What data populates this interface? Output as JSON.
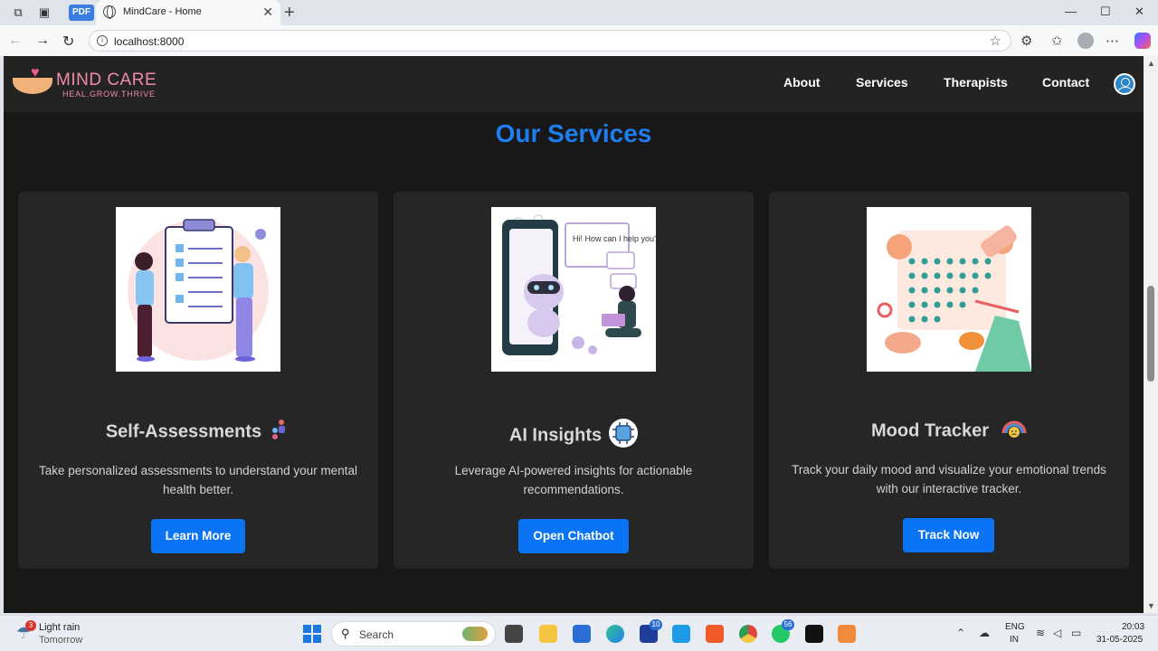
{
  "browser": {
    "pdf_badge": "PDF",
    "tab_title": "MindCare - Home",
    "url": "localhost:8000"
  },
  "site": {
    "logo_title": "MIND CARE",
    "logo_tagline": "HEAL.GROW.THRIVE",
    "nav": [
      "About",
      "Services",
      "Therapists",
      "Contact"
    ],
    "section_title": "Our Services",
    "cards": [
      {
        "title": "Self-Assessments",
        "description": "Take personalized assessments to understand your mental health better.",
        "button": "Learn More",
        "emoji_icon": "person-standing-icon"
      },
      {
        "title": "AI Insights",
        "description": "Leverage AI-powered insights for actionable recommendations.",
        "button": "Open Chatbot",
        "emoji_icon": "ai-chip-icon",
        "illustration_text": "Hi! How can I help you?"
      },
      {
        "title": "Mood Tracker",
        "description": "Track your daily mood and visualize your emotional trends with our interactive tracker.",
        "button": "Track Now",
        "emoji_icon": "sad-face-rainbow-icon"
      }
    ]
  },
  "taskbar": {
    "weather": "Light rain",
    "weather_sub": "Tomorrow",
    "weather_badge": "3",
    "search_placeholder": "Search",
    "badge_l": "10",
    "badge_whatsapp": "56",
    "lang_top": "ENG",
    "lang_bottom": "IN",
    "time": "20:03",
    "date": "31-05-2025"
  },
  "colors": {
    "accent": "#0a74f5",
    "title_blue": "#1e7ef0",
    "logo_pink": "#f08aa6",
    "page_bg": "#181818",
    "card_bg": "#262626"
  }
}
